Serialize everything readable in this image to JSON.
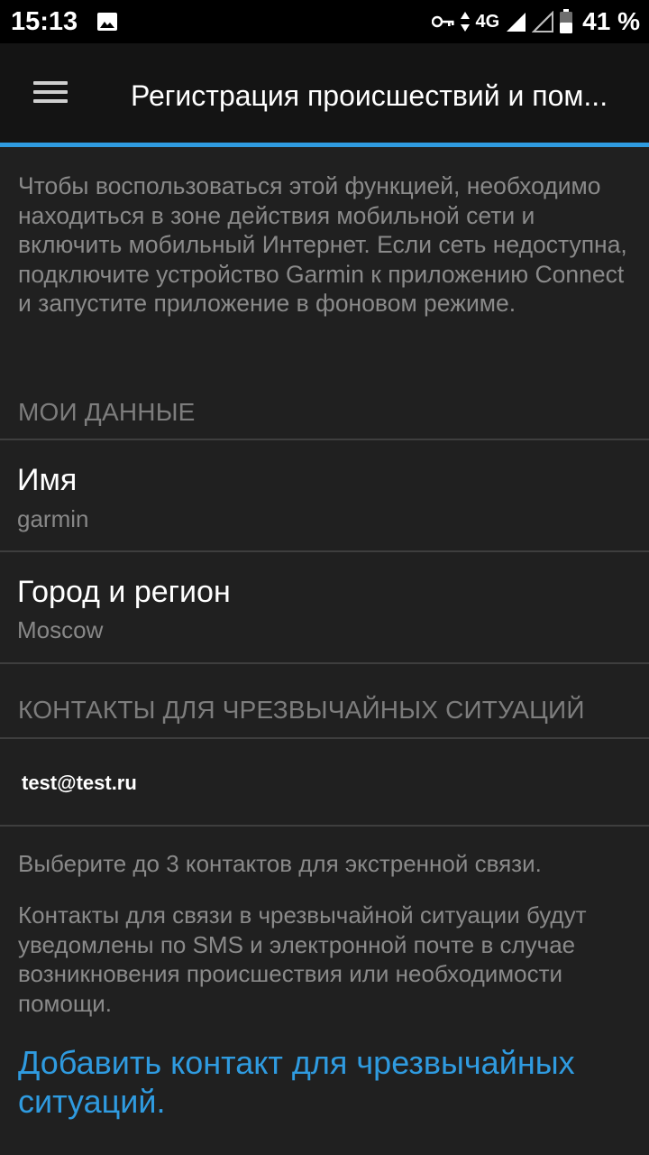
{
  "status_bar": {
    "time": "15:13",
    "network_type": "4G",
    "battery": "41 %",
    "icons": [
      "image-icon",
      "vpn-key-icon",
      "data-arrows-icon",
      "signal-icon",
      "signal-empty-icon",
      "battery-icon"
    ]
  },
  "app_bar": {
    "title": "Регистрация происшествий и пом..."
  },
  "intro": {
    "text": "Чтобы воспользоваться этой функцией, необходимо находиться в зоне действия мобильной сети и включить мобильный Интернет. Если сеть недоступна, подключите устройство Garmin к приложению Connect и запустите приложение в фоновом режиме."
  },
  "my_data": {
    "header": "МОИ ДАННЫЕ",
    "name": {
      "label": "Имя",
      "value": "garmin"
    },
    "city": {
      "label": "Город и регион",
      "value": "Moscow"
    }
  },
  "emergency_contacts": {
    "header": "КОНТАКТЫ ДЛЯ ЧРЕЗВЫЧАЙНЫХ СИТУАЦИЙ",
    "contacts": [
      {
        "email": "test@test.ru"
      }
    ],
    "hint_select": "Выберите до 3 контактов для экстренной связи.",
    "hint_notify": "Контакты для связи в чрезвычайной ситуации будут уведомлены по SMS и электронной почте в случае возникновения происшествия или необходимости помощи.",
    "add_link": "Добавить контакт для чрезвычайных ситуаций."
  },
  "colors": {
    "accent": "#2f9be0",
    "background": "#202020",
    "app_bar": "#141414",
    "status_bar": "#000000",
    "secondary_text": "#8a8a8a",
    "divider": "#3e3e3e"
  }
}
